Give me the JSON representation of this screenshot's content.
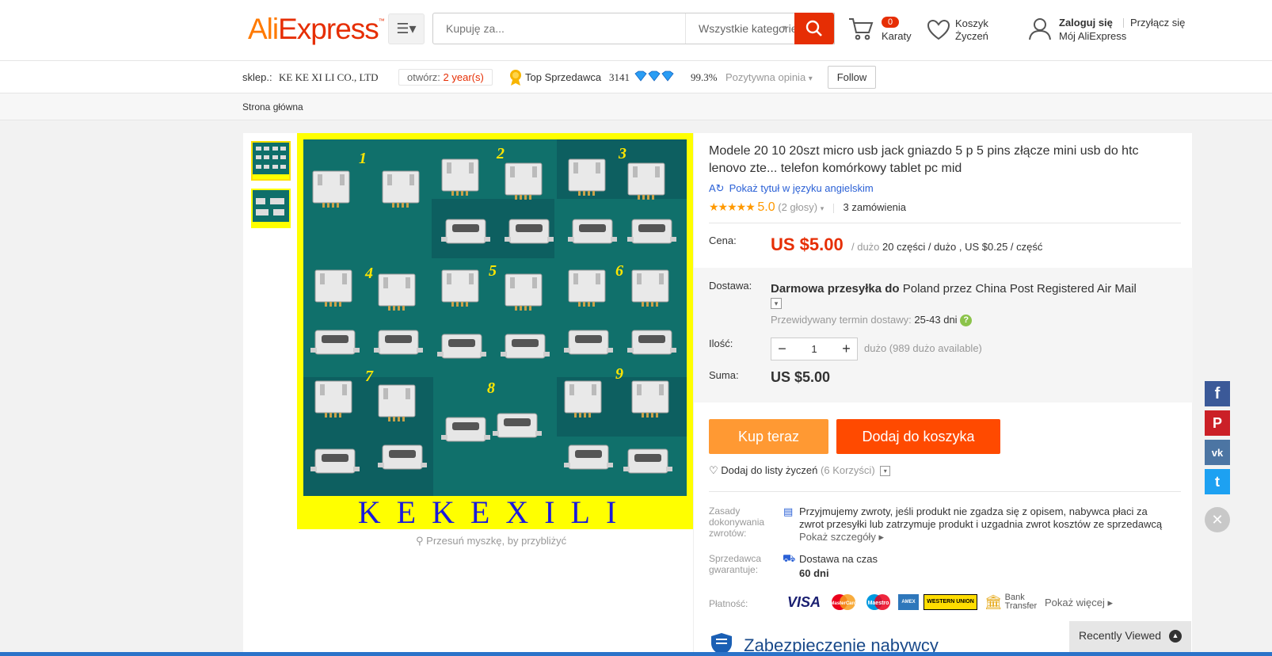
{
  "header": {
    "logo_main": "AliExpress",
    "logo_tm": "™",
    "search_placeholder": "Kupuję za...",
    "search_category": "Wszystkie kategorie",
    "cart_count": "0",
    "cart_label": "Karaty",
    "wish_line1": "Koszyk",
    "wish_line2": "Życzeń",
    "signin": "Zaloguj się",
    "join": "Przyłącz się",
    "my_account": "Mój AliExpress"
  },
  "store": {
    "label": "sklep.:",
    "name": "KE KE XI LI CO., LTD",
    "open_label": "otwórz:",
    "open_value": "2 year(s)",
    "top_seller": "Top Sprzedawca",
    "score": "3141",
    "positive_pct": "99.3%",
    "positive_label": "Pozytywna opinia",
    "follow": "Follow"
  },
  "subnav": {
    "home": "Strona główna"
  },
  "gallery": {
    "watermark": "KEKEXILI",
    "zoom_hint": "Przesuń myszkę, by przybliżyć",
    "labels": [
      "1",
      "2",
      "3",
      "4",
      "5",
      "6",
      "7",
      "8",
      "9"
    ]
  },
  "product": {
    "title": "Modele 20 10 20szt micro usb jack gniazdo 5 p 5 pins złącze mini usb do htc lenovo zte... telefon komórkowy tablet pc mid",
    "show_english": "Pokaż tytuł w języku angielskim",
    "stars": "★★★★★",
    "rating": "5.0",
    "votes": "(2 głosy)",
    "orders": "3 zamówienia",
    "price_label": "Cena:",
    "price": "US $5.00",
    "price_unit_pre": "/ dużo",
    "price_unit_detail": "20 części / dużo , US $0.25 / część",
    "delivery_label": "Dostawa:",
    "shipping_bold": "Darmowa przesyłka do",
    "shipping_rest": "Poland przez China Post Registered Air Mail",
    "est_label": "Przewidywany termin dostawy:",
    "est_value": "25-43 dni",
    "qty_label": "Ilość:",
    "qty_value": "1",
    "qty_available": "dużo (989 dużo available)",
    "total_label": "Suma:",
    "total": "US $5.00",
    "buy_now": "Kup teraz",
    "add_to_cart": "Dodaj do koszyka",
    "wishlist": "Dodaj do listy życzeń",
    "wishlist_count": "(6 Korzyści)",
    "returns_label": "Zasady dokonywania zwrotów:",
    "returns_text": "Przyjmujemy zwroty, jeśli produkt nie zgadza się z opisem, nabywca płaci za zwrot przesyłki lub zatrzymuje produkt i uzgadnia zwrot kosztów ze sprzedawcą",
    "returns_more": "Pokaż szczegóły",
    "guarantee_label": "Sprzedawca gwarantuje:",
    "guarantee_1": "Dostawa na czas",
    "guarantee_2": "60 dni",
    "payment_label": "Płatność:",
    "pay_visa": "VISA",
    "pay_mc": "MasterCard",
    "pay_maestro": "Maestro",
    "pay_amex": "AMEX",
    "pay_wu": "WESTERN UNION",
    "pay_bank_1": "Bank",
    "pay_bank_2": "Transfer",
    "pay_more": "Pokaż więcej",
    "protection": "Zabezpieczenie nabywcy"
  },
  "social": {
    "fb": "f",
    "pin": "P",
    "vk": "vk",
    "tw": "t"
  },
  "recent": "Recently Viewed",
  "colors": {
    "accent": "#e62e04",
    "orange": "#ff9933",
    "cart_btn": "#ff4a00",
    "link": "#2b61d6"
  }
}
